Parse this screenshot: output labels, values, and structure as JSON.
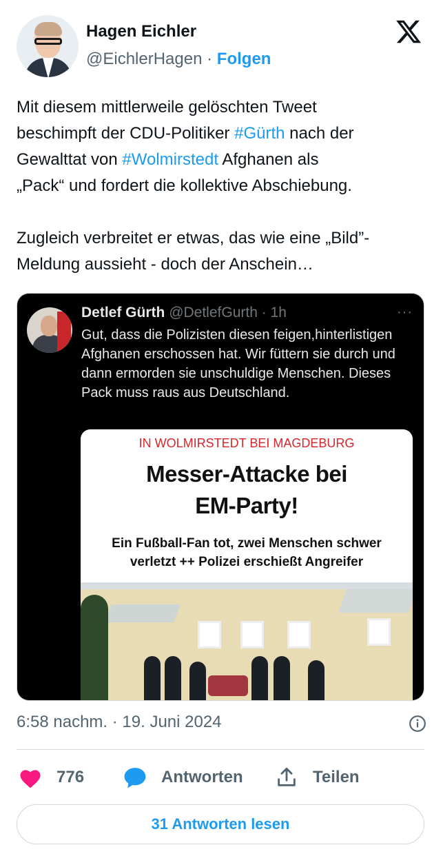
{
  "author": {
    "name": "Hagen Eichler",
    "handle": "@EichlerHagen",
    "separator": "·",
    "follow_label": "Folgen"
  },
  "tweet": {
    "line1": "Mit diesem mittlerweile gelöschten Tweet",
    "line2_pre": "beschimpft der CDU-Politiker ",
    "tag1": "#Gürth",
    "line2_post": " nach der",
    "line3_pre": "Gewalttat von ",
    "tag2": "#Wolmirstedt",
    "line3_post": " Afghanen als",
    "line4": "„Pack“ und fordert die kollektive Abschiebung.",
    "line5": "Zugleich verbreitet er etwas, das wie eine „Bild”-",
    "line6": "Meldung aussieht - doch der Anschein…"
  },
  "embedded": {
    "name": "Detlef Gürth",
    "handle_time": "@DetlefGurth · 1h",
    "more": "···",
    "text": "Gut, dass die Polizisten diesen feigen,hinterlistigen Afghanen erschossen hat. Wir füttern sie durch und dann ermorden sie unschuldige Menschen. Dieses Pack muss raus aus Deutschland.",
    "news": {
      "kicker": "IN WOLMIRSTEDT BEI MAGDEBURG",
      "headline_line1": "Messer-Attacke bei",
      "headline_line2": "EM-Party!",
      "sub_line1": "Ein Fußball-Fan tot, zwei Menschen schwer",
      "sub_line2": "verletzt ++ Polizei erschießt Angreifer"
    }
  },
  "meta": {
    "timestamp": "6:58 nachm. · 19. Juni 2024"
  },
  "actions": {
    "like_count": "776",
    "reply_label": "Antworten",
    "share_label": "Teilen"
  },
  "read_replies_label": "31 Antworten lesen",
  "colors": {
    "accent": "#1d9bf0",
    "like": "#f91880",
    "muted": "#536471",
    "kicker_red": "#d8262b"
  },
  "icons": [
    "x-logo-icon",
    "info-icon",
    "heart-icon",
    "reply-bubble-icon",
    "share-icon"
  ]
}
